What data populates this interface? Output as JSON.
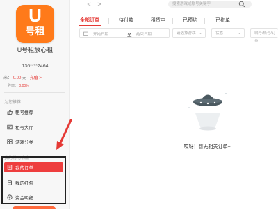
{
  "sidebar": {
    "logo": {
      "big": "U",
      "small": "号租"
    },
    "app_name": "U号租放心租",
    "user": {
      "phone": "136****2464"
    },
    "balance": {
      "label": "米",
      "amount": "0.00",
      "unit": "元",
      "recharge": "充值",
      "arrow": ">"
    },
    "winrate": {
      "label": "胜率：",
      "value": "0.00%"
    },
    "section_recommend": "为您推荐",
    "items": [
      {
        "label": "租号推荐",
        "icon": "thumb-icon"
      },
      {
        "label": "租号大厅",
        "icon": "hall-icon"
      },
      {
        "label": "游戏分类",
        "icon": "grid-icon"
      }
    ],
    "section_mine": "我的常用功能",
    "mine_items": [
      {
        "label": "我的订单",
        "icon": "order-icon",
        "active": true
      },
      {
        "label": "我的红包",
        "icon": "redpacket-icon"
      },
      {
        "label": "资金明细",
        "icon": "funds-icon"
      }
    ]
  },
  "topbar": {
    "back": "<",
    "forward": ">",
    "search_placeholder": "搜索游戏或账号关键字"
  },
  "tabs": [
    {
      "label": "全部订单",
      "active": true
    },
    {
      "label": "待付款"
    },
    {
      "label": "租赁中"
    },
    {
      "label": "已预约"
    },
    {
      "label": "已撤单"
    }
  ],
  "filters": {
    "date_start": "开始日期",
    "date_to": "至",
    "date_end": "结束日期",
    "select_game": "请选择游戏",
    "select_status": "状态",
    "order_search": "编号/账号/订单"
  },
  "empty": {
    "message": "哎呀！暂无相关订单~"
  },
  "colors": {
    "accent": "#e53935",
    "logo": "#ff7a1a",
    "annotation": "#e53935"
  }
}
